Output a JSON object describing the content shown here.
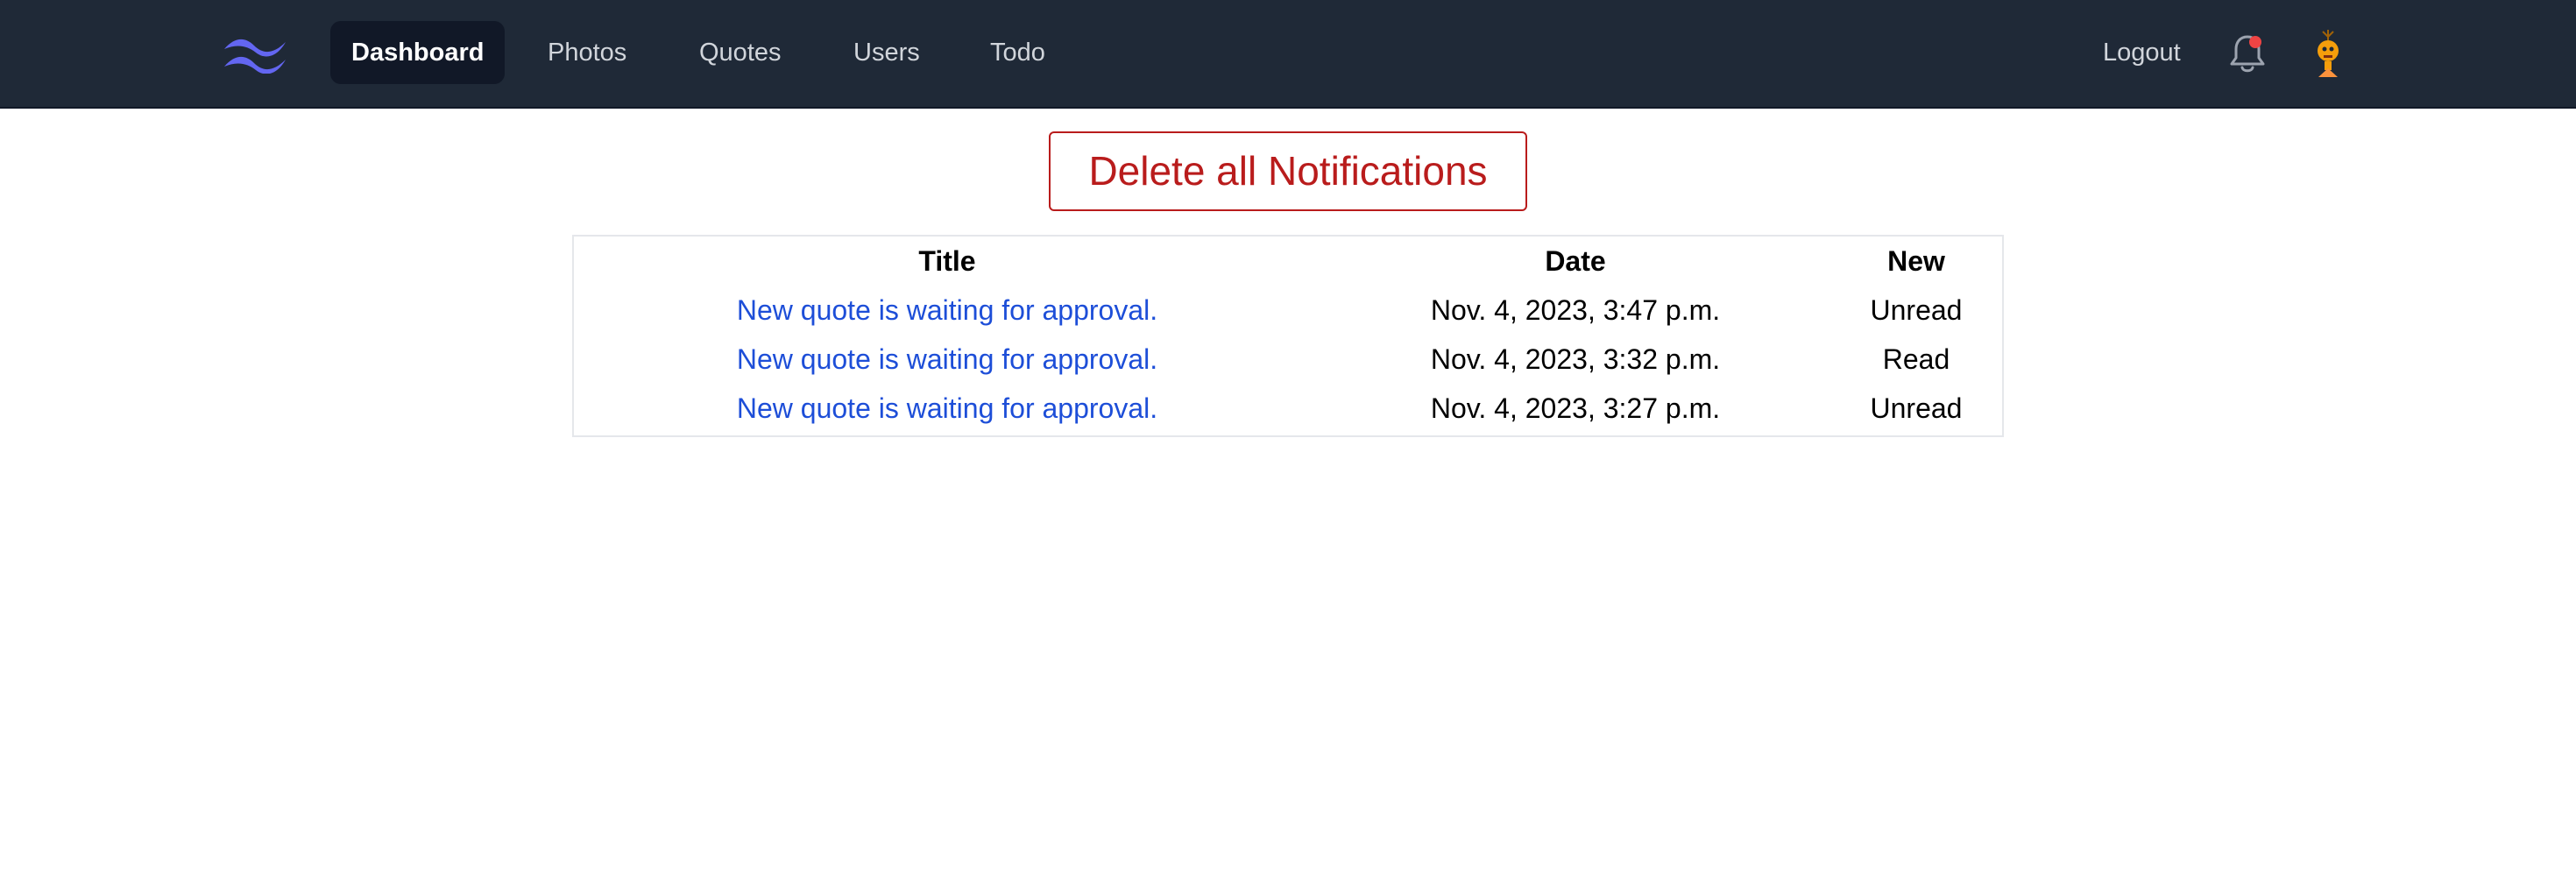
{
  "nav": {
    "logo_icon": "tailwind-logo-icon",
    "items": [
      {
        "label": "Dashboard",
        "active": true
      },
      {
        "label": "Photos",
        "active": false
      },
      {
        "label": "Quotes",
        "active": false
      },
      {
        "label": "Users",
        "active": false
      },
      {
        "label": "Todo",
        "active": false
      }
    ],
    "logout_label": "Logout",
    "bell_icon": "bell-icon",
    "avatar_icon": "robot-avatar-icon"
  },
  "colors": {
    "navbar_bg": "#1f2937",
    "active_bg": "#111827",
    "danger": "#b91c1c",
    "link": "#1d4ed8",
    "badge": "#ef4444",
    "logo": "#6366f1"
  },
  "main": {
    "delete_button_label": "Delete all Notifications",
    "table": {
      "headers": {
        "title": "Title",
        "date": "Date",
        "new": "New"
      },
      "rows": [
        {
          "title": "New quote is waiting for approval.",
          "date": "Nov. 4, 2023, 3:47 p.m.",
          "status": "Unread"
        },
        {
          "title": "New quote is waiting for approval.",
          "date": "Nov. 4, 2023, 3:32 p.m.",
          "status": "Read"
        },
        {
          "title": "New quote is waiting for approval.",
          "date": "Nov. 4, 2023, 3:27 p.m.",
          "status": "Unread"
        }
      ]
    }
  }
}
